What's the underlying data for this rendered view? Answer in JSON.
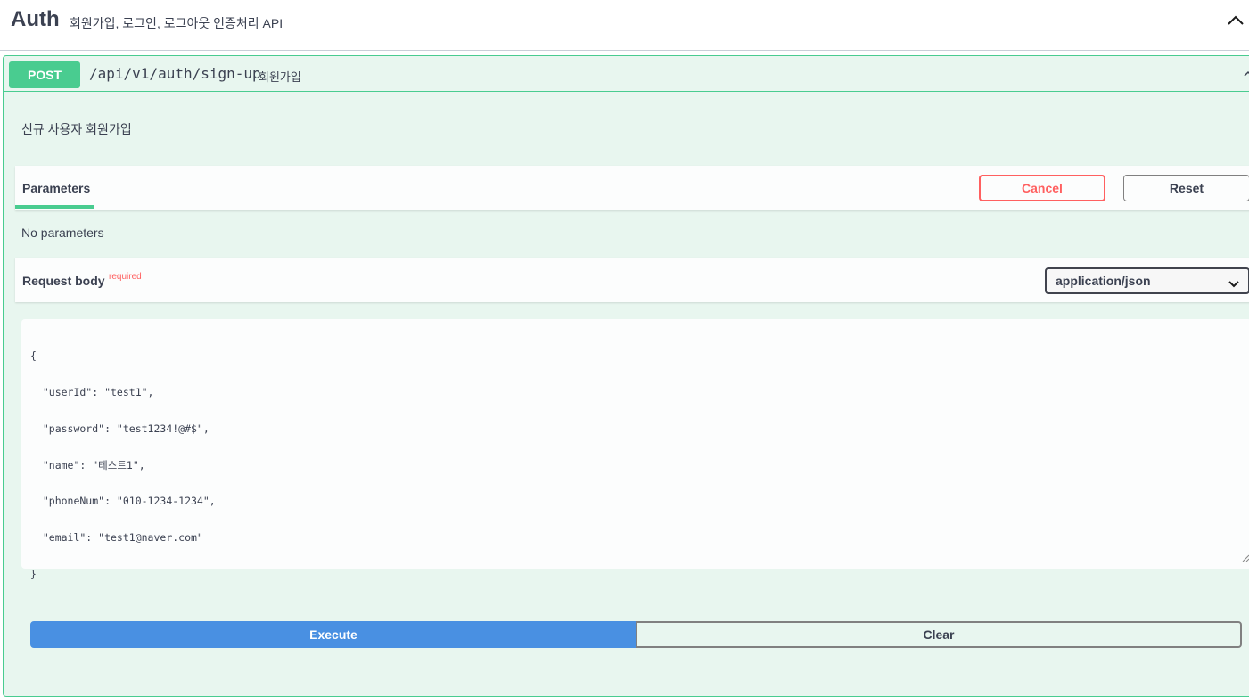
{
  "tag": {
    "name": "Auth",
    "description": "회원가입, 로그인, 로그아웃 인증처리 API",
    "collapse_icon": "chevron-up-icon"
  },
  "operation": {
    "method": "POST",
    "path": "/api/v1/auth/sign-up",
    "summary": "회원가입",
    "description": "신규 사용자 회원가입",
    "colors": {
      "post": "#49cc90",
      "post_bg": "#e8f6ef"
    }
  },
  "parameters": {
    "tab_label": "Parameters",
    "cancel_label": "Cancel",
    "reset_label": "Reset",
    "empty_text": "No parameters"
  },
  "request_body": {
    "title": "Request body",
    "required_label": "required",
    "content_type": "application/json",
    "lines": [
      "{",
      "  \"userId\": \"test1\",",
      "  \"password\": \"test1234!@#$\",",
      "  \"name\": \"테스트1\",",
      "  \"phoneNum\": \"010-1234-1234\",",
      "  \"email\": \"test1@naver.com\"",
      "}"
    ]
  },
  "actions": {
    "execute_label": "Execute",
    "clear_label": "Clear",
    "execute_color": "#4990e2"
  }
}
